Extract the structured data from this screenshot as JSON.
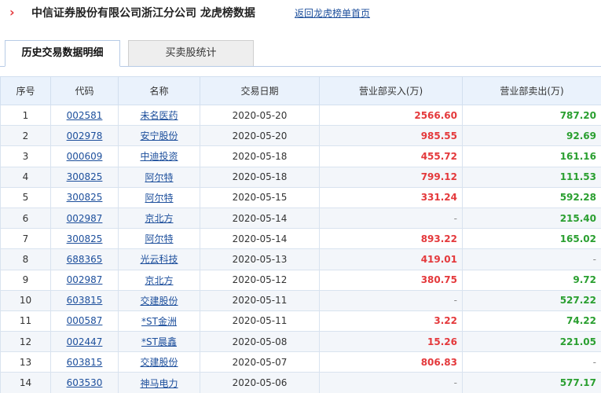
{
  "header": {
    "arrow": "›",
    "title": "中信证券股份有限公司浙江分公司 龙虎榜数据",
    "back_link": "返回龙虎榜单首页"
  },
  "tabs": [
    {
      "label": "历史交易数据明细",
      "active": true
    },
    {
      "label": "买卖股统计",
      "active": false
    }
  ],
  "table": {
    "columns": [
      "序号",
      "代码",
      "名称",
      "交易日期",
      "营业部买入(万)",
      "营业部卖出(万)"
    ],
    "rows": [
      {
        "no": "1",
        "code": "002581",
        "name": "未名医药",
        "date": "2020-05-20",
        "buy": "2566.60",
        "sell": "787.20"
      },
      {
        "no": "2",
        "code": "002978",
        "name": "安宁股份",
        "date": "2020-05-20",
        "buy": "985.55",
        "sell": "92.69"
      },
      {
        "no": "3",
        "code": "000609",
        "name": "中迪投资",
        "date": "2020-05-18",
        "buy": "455.72",
        "sell": "161.16"
      },
      {
        "no": "4",
        "code": "300825",
        "name": "阿尔特",
        "date": "2020-05-18",
        "buy": "799.12",
        "sell": "111.53"
      },
      {
        "no": "5",
        "code": "300825",
        "name": "阿尔特",
        "date": "2020-05-15",
        "buy": "331.24",
        "sell": "592.28"
      },
      {
        "no": "6",
        "code": "002987",
        "name": "京北方",
        "date": "2020-05-14",
        "buy": "-",
        "sell": "215.40"
      },
      {
        "no": "7",
        "code": "300825",
        "name": "阿尔特",
        "date": "2020-05-14",
        "buy": "893.22",
        "sell": "165.02"
      },
      {
        "no": "8",
        "code": "688365",
        "name": "光云科技",
        "date": "2020-05-13",
        "buy": "419.01",
        "sell": "-"
      },
      {
        "no": "9",
        "code": "002987",
        "name": "京北方",
        "date": "2020-05-12",
        "buy": "380.75",
        "sell": "9.72"
      },
      {
        "no": "10",
        "code": "603815",
        "name": "交建股份",
        "date": "2020-05-11",
        "buy": "-",
        "sell": "527.22"
      },
      {
        "no": "11",
        "code": "000587",
        "name": "*ST金洲",
        "date": "2020-05-11",
        "buy": "3.22",
        "sell": "74.22"
      },
      {
        "no": "12",
        "code": "002447",
        "name": "*ST晨鑫",
        "date": "2020-05-08",
        "buy": "15.26",
        "sell": "221.05"
      },
      {
        "no": "13",
        "code": "603815",
        "name": "交建股份",
        "date": "2020-05-07",
        "buy": "806.83",
        "sell": "-"
      },
      {
        "no": "14",
        "code": "603530",
        "name": "神马电力",
        "date": "2020-05-06",
        "buy": "-",
        "sell": "577.17"
      }
    ]
  },
  "colors": {
    "buy": "#e4393c",
    "sell": "#2a9f30",
    "link": "#1d4f9c",
    "header_bg": "#eaf2fc"
  }
}
